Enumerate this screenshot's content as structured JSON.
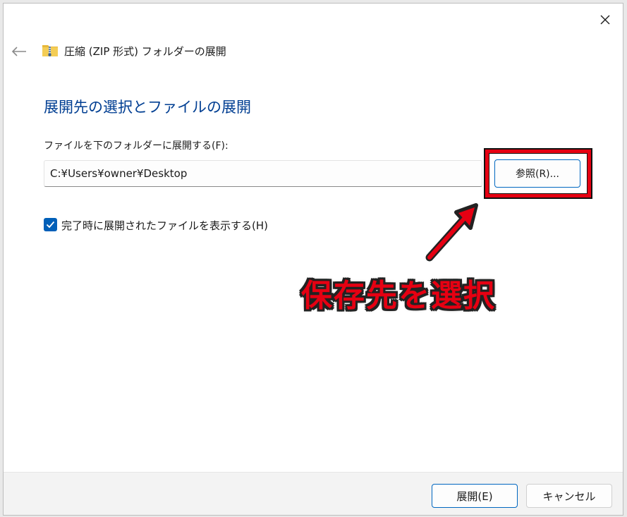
{
  "window": {
    "title": "圧縮 (ZIP 形式) フォルダーの展開"
  },
  "icons": {
    "close": "close-icon",
    "back": "arrow-left-icon",
    "zip_folder": "zip-folder-icon",
    "checkmark": "checkmark-icon"
  },
  "main": {
    "heading": "展開先の選択とファイルの展開",
    "destination_label": "ファイルを下のフォルダーに展開する(F):",
    "destination_path": "C:¥Users¥owner¥Desktop",
    "browse_label": "参照(R)...",
    "show_files_checked": true,
    "show_files_label": "完了時に展開されたファイルを表示する(H)"
  },
  "annotation": {
    "text": "保存先を選択",
    "color": "#e60012"
  },
  "footer": {
    "extract_label": "展開(E)",
    "cancel_label": "キャンセル"
  },
  "colors": {
    "accent": "#005fb8",
    "heading": "#003e92"
  }
}
